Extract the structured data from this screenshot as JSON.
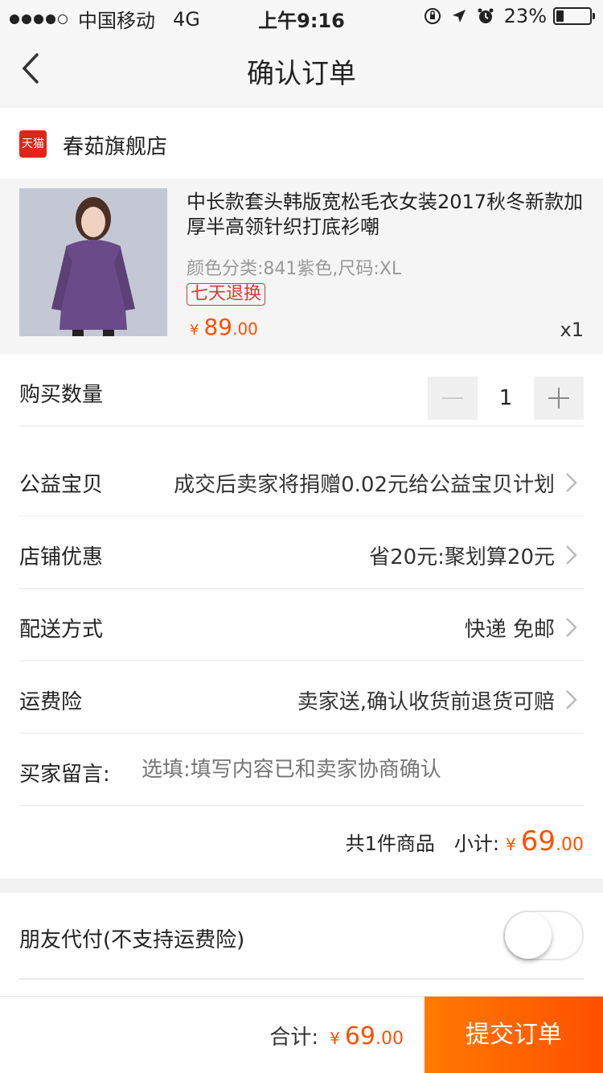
{
  "status_bar": {
    "carrier": "中国移动",
    "network": "4G",
    "time": "上午9:16",
    "battery_text": "23%",
    "battery_level": 0.23,
    "signal_dots": [
      true,
      true,
      true,
      true,
      false
    ],
    "icons": [
      "orientation-lock-icon",
      "location-arrow-icon",
      "alarm-icon"
    ]
  },
  "nav": {
    "title": "确认订单",
    "back_icon": "chevron-left-icon"
  },
  "shop": {
    "badge": "天猫",
    "name": "春茹旗舰店"
  },
  "product": {
    "title": "中长款套头韩版宽松毛衣女装2017秋冬新款加厚半高领针织打底衫嘲",
    "spec": "颜色分类:841紫色,尺码:XL",
    "tag": "七天退换",
    "price_symbol": "¥",
    "price_int": "89",
    "price_dec": ".00",
    "qty": "x1"
  },
  "rows": {
    "quantity": {
      "label": "购买数量",
      "value": "1"
    },
    "charity": {
      "label": "公益宝贝",
      "value": "成交后卖家将捐赠0.02元给公益宝贝计划"
    },
    "discount": {
      "label": "店铺优惠",
      "value": "省20元:聚划算20元"
    },
    "delivery": {
      "label": "配送方式",
      "value": "快递 免邮"
    },
    "insurance": {
      "label": "运费险",
      "value": "卖家送,确认收货前退货可赔"
    },
    "message": {
      "label": "买家留言:",
      "placeholder": "选填:填写内容已和卖家协商确认"
    }
  },
  "summary": {
    "count": "共1件商品",
    "subtotal_label": "小计:",
    "symbol": "¥",
    "amount_int": "69",
    "amount_dec": ".00"
  },
  "friend_pay": {
    "label": "朋友代付(不支持运费险)",
    "enabled": false
  },
  "footer": {
    "total_label": "合计:",
    "symbol": "¥",
    "amount_int": "69",
    "amount_dec": ".00",
    "submit_label": "提交订单"
  },
  "colors": {
    "accent": "#ff5000",
    "tmall_red": "#e1251b",
    "tag_red": "#d43c33"
  }
}
